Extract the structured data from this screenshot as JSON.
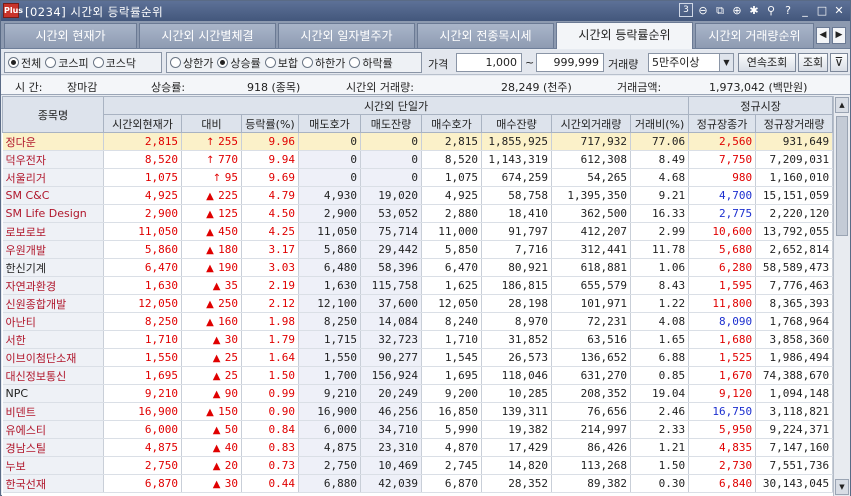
{
  "window": {
    "title": "[0234] 시간외 등락률순위",
    "app_badge": "Plus"
  },
  "title_tools": [
    {
      "name": "screen-number-icon",
      "glyph": "3"
    },
    {
      "name": "zoom-out-icon",
      "glyph": "⊖"
    },
    {
      "name": "link-icon",
      "glyph": "⧉"
    },
    {
      "name": "zoom-in-icon",
      "glyph": "⊕"
    },
    {
      "name": "settings-icon",
      "glyph": "✱"
    },
    {
      "name": "pin-icon",
      "glyph": "⚲"
    },
    {
      "name": "help-icon",
      "glyph": "?"
    },
    {
      "name": "minimize-icon",
      "glyph": "_"
    },
    {
      "name": "maximize-icon",
      "glyph": "□"
    },
    {
      "name": "close-icon",
      "glyph": "✕"
    }
  ],
  "tabs": [
    {
      "label": "시간외 현재가",
      "active": false
    },
    {
      "label": "시간외 시간별체결",
      "active": false
    },
    {
      "label": "시간외 일자별주가",
      "active": false
    },
    {
      "label": "시간외 전종목시세",
      "active": false
    },
    {
      "label": "시간외 등락률순위",
      "active": true
    },
    {
      "label": "시간외 거래량순위",
      "active": false
    }
  ],
  "tab_nav": {
    "prev": "◀",
    "next": "▶"
  },
  "filters": {
    "market": [
      {
        "label": "전체",
        "checked": true
      },
      {
        "label": "코스피",
        "checked": false
      },
      {
        "label": "코스닥",
        "checked": false
      }
    ],
    "trend": [
      {
        "label": "상한가",
        "checked": false
      },
      {
        "label": "상승률",
        "checked": true
      },
      {
        "label": "보합",
        "checked": false
      },
      {
        "label": "하한가",
        "checked": false
      },
      {
        "label": "하락률",
        "checked": false
      }
    ],
    "price_label": "가격",
    "price_min": "1,000",
    "price_sep": "~",
    "price_max": "999,999",
    "volume_label": "거래량",
    "volume_option": "5만주이상",
    "continuous_button": "연속조회",
    "query_button": "조회",
    "filter_icon": "filter-icon"
  },
  "info": {
    "time_label": "시 간:",
    "time_value": "장마감",
    "rising_label": "상승률:",
    "rising_value": "918 (종목)",
    "volume_label": "시간외 거래량:",
    "volume_value": "28,249 (천주)",
    "amount_label": "거래금액:",
    "amount_value": "1,973,042 (백만원)"
  },
  "table": {
    "group_headers": {
      "name": "종목명",
      "offhours": "시간외 단일가",
      "regular": "정규시장"
    },
    "columns": [
      "시간외현재가",
      "대비",
      "등락률(%)",
      "매도호가",
      "매도잔량",
      "매수호가",
      "매수잔량",
      "시간외거래량",
      "거래비(%)",
      "정규장종가",
      "정규장거래량"
    ],
    "rows": [
      {
        "name": "정다운",
        "name_color": "up",
        "price": "2,815",
        "arrow": "↑",
        "diff": "255",
        "rate": "9.96",
        "ask": "0",
        "ask_qty": "0",
        "bid": "2,815",
        "bid_qty": "1,855,925",
        "vol": "717,932",
        "ratio": "77.06",
        "close": "2,560",
        "close_color": "up",
        "reg_vol": "931,649",
        "selected": true
      },
      {
        "name": "덕우전자",
        "name_color": "up",
        "price": "8,520",
        "arrow": "↑",
        "diff": "770",
        "rate": "9.94",
        "ask": "0",
        "ask_qty": "0",
        "bid": "8,520",
        "bid_qty": "1,143,319",
        "vol": "612,308",
        "ratio": "8.49",
        "close": "7,750",
        "close_color": "up",
        "reg_vol": "7,209,031",
        "selected": false
      },
      {
        "name": "서울리거",
        "name_color": "up",
        "price": "1,075",
        "arrow": "↑",
        "diff": "95",
        "rate": "9.69",
        "ask": "0",
        "ask_qty": "0",
        "bid": "1,075",
        "bid_qty": "674,259",
        "vol": "54,265",
        "ratio": "4.68",
        "close": "980",
        "close_color": "up",
        "reg_vol": "1,160,010",
        "selected": false
      },
      {
        "name": "SM C&C",
        "name_color": "up",
        "price": "4,925",
        "arrow": "▲",
        "diff": "225",
        "rate": "4.79",
        "ask": "4,930",
        "ask_qty": "19,020",
        "bid": "4,925",
        "bid_qty": "58,758",
        "vol": "1,395,350",
        "ratio": "9.21",
        "close": "4,700",
        "close_color": "dn",
        "reg_vol": "15,151,059",
        "selected": false
      },
      {
        "name": "SM Life Design",
        "name_color": "up",
        "price": "2,900",
        "arrow": "▲",
        "diff": "125",
        "rate": "4.50",
        "ask": "2,900",
        "ask_qty": "53,052",
        "bid": "2,880",
        "bid_qty": "18,410",
        "vol": "362,500",
        "ratio": "16.33",
        "close": "2,775",
        "close_color": "dn",
        "reg_vol": "2,220,120",
        "selected": false
      },
      {
        "name": "로보로보",
        "name_color": "up",
        "price": "11,050",
        "arrow": "▲",
        "diff": "450",
        "rate": "4.25",
        "ask": "11,050",
        "ask_qty": "75,714",
        "bid": "11,000",
        "bid_qty": "91,797",
        "vol": "412,207",
        "ratio": "2.99",
        "close": "10,600",
        "close_color": "up",
        "reg_vol": "13,792,055",
        "selected": false
      },
      {
        "name": "우원개발",
        "name_color": "up",
        "price": "5,860",
        "arrow": "▲",
        "diff": "180",
        "rate": "3.17",
        "ask": "5,860",
        "ask_qty": "29,442",
        "bid": "5,850",
        "bid_qty": "7,716",
        "vol": "312,441",
        "ratio": "11.78",
        "close": "5,680",
        "close_color": "up",
        "reg_vol": "2,652,814",
        "selected": false
      },
      {
        "name": "한신기계",
        "name_color": "blk",
        "price": "6,470",
        "arrow": "▲",
        "diff": "190",
        "rate": "3.03",
        "ask": "6,480",
        "ask_qty": "58,396",
        "bid": "6,470",
        "bid_qty": "80,921",
        "vol": "618,881",
        "ratio": "1.06",
        "close": "6,280",
        "close_color": "up",
        "reg_vol": "58,589,473",
        "selected": false
      },
      {
        "name": "자연과환경",
        "name_color": "up",
        "price": "1,630",
        "arrow": "▲",
        "diff": "35",
        "rate": "2.19",
        "ask": "1,630",
        "ask_qty": "115,758",
        "bid": "1,625",
        "bid_qty": "186,815",
        "vol": "655,579",
        "ratio": "8.43",
        "close": "1,595",
        "close_color": "up",
        "reg_vol": "7,776,463",
        "selected": false
      },
      {
        "name": "신원종합개발",
        "name_color": "up",
        "price": "12,050",
        "arrow": "▲",
        "diff": "250",
        "rate": "2.12",
        "ask": "12,100",
        "ask_qty": "37,600",
        "bid": "12,050",
        "bid_qty": "28,198",
        "vol": "101,971",
        "ratio": "1.22",
        "close": "11,800",
        "close_color": "up",
        "reg_vol": "8,365,393",
        "selected": false
      },
      {
        "name": "아난티",
        "name_color": "up",
        "price": "8,250",
        "arrow": "▲",
        "diff": "160",
        "rate": "1.98",
        "ask": "8,250",
        "ask_qty": "14,084",
        "bid": "8,240",
        "bid_qty": "8,970",
        "vol": "72,231",
        "ratio": "4.08",
        "close": "8,090",
        "close_color": "dn",
        "reg_vol": "1,768,964",
        "selected": false
      },
      {
        "name": "서한",
        "name_color": "up",
        "price": "1,710",
        "arrow": "▲",
        "diff": "30",
        "rate": "1.79",
        "ask": "1,715",
        "ask_qty": "32,723",
        "bid": "1,710",
        "bid_qty": "31,852",
        "vol": "63,516",
        "ratio": "1.65",
        "close": "1,680",
        "close_color": "up",
        "reg_vol": "3,858,360",
        "selected": false
      },
      {
        "name": "이브이첨단소재",
        "name_color": "up",
        "price": "1,550",
        "arrow": "▲",
        "diff": "25",
        "rate": "1.64",
        "ask": "1,550",
        "ask_qty": "90,277",
        "bid": "1,545",
        "bid_qty": "26,573",
        "vol": "136,652",
        "ratio": "6.88",
        "close": "1,525",
        "close_color": "up",
        "reg_vol": "1,986,494",
        "selected": false
      },
      {
        "name": "대신정보통신",
        "name_color": "up",
        "price": "1,695",
        "arrow": "▲",
        "diff": "25",
        "rate": "1.50",
        "ask": "1,700",
        "ask_qty": "156,924",
        "bid": "1,695",
        "bid_qty": "118,046",
        "vol": "631,270",
        "ratio": "0.85",
        "close": "1,670",
        "close_color": "up",
        "reg_vol": "74,388,670",
        "selected": false
      },
      {
        "name": "NPC",
        "name_color": "blk",
        "price": "9,210",
        "arrow": "▲",
        "diff": "90",
        "rate": "0.99",
        "ask": "9,210",
        "ask_qty": "20,249",
        "bid": "9,200",
        "bid_qty": "10,285",
        "vol": "208,352",
        "ratio": "19.04",
        "close": "9,120",
        "close_color": "up",
        "reg_vol": "1,094,148",
        "selected": false
      },
      {
        "name": "비덴트",
        "name_color": "up",
        "price": "16,900",
        "arrow": "▲",
        "diff": "150",
        "rate": "0.90",
        "ask": "16,900",
        "ask_qty": "46,256",
        "bid": "16,850",
        "bid_qty": "139,311",
        "vol": "76,656",
        "ratio": "2.46",
        "close": "16,750",
        "close_color": "dn",
        "reg_vol": "3,118,821",
        "selected": false
      },
      {
        "name": "유에스티",
        "name_color": "up",
        "price": "6,000",
        "arrow": "▲",
        "diff": "50",
        "rate": "0.84",
        "ask": "6,000",
        "ask_qty": "34,710",
        "bid": "5,990",
        "bid_qty": "19,382",
        "vol": "214,997",
        "ratio": "2.33",
        "close": "5,950",
        "close_color": "up",
        "reg_vol": "9,224,371",
        "selected": false
      },
      {
        "name": "경남스틸",
        "name_color": "up",
        "price": "4,875",
        "arrow": "▲",
        "diff": "40",
        "rate": "0.83",
        "ask": "4,875",
        "ask_qty": "23,310",
        "bid": "4,870",
        "bid_qty": "17,429",
        "vol": "86,426",
        "ratio": "1.21",
        "close": "4,835",
        "close_color": "up",
        "reg_vol": "7,147,160",
        "selected": false
      },
      {
        "name": "누보",
        "name_color": "up",
        "price": "2,750",
        "arrow": "▲",
        "diff": "20",
        "rate": "0.73",
        "ask": "2,750",
        "ask_qty": "10,469",
        "bid": "2,745",
        "bid_qty": "14,820",
        "vol": "113,268",
        "ratio": "1.50",
        "close": "2,730",
        "close_color": "up",
        "reg_vol": "7,551,736",
        "selected": false
      },
      {
        "name": "한국선재",
        "name_color": "up",
        "price": "6,870",
        "arrow": "▲",
        "diff": "30",
        "rate": "0.44",
        "ask": "6,880",
        "ask_qty": "42,039",
        "bid": "6,870",
        "bid_qty": "28,352",
        "vol": "89,382",
        "ratio": "0.30",
        "close": "6,840",
        "close_color": "up",
        "reg_vol": "30,143,045",
        "selected": false
      }
    ]
  },
  "colors": {
    "up": "#e00000",
    "down": "#1c2fcf",
    "selected_row": "#fbf1c9",
    "header_bg": "#dde3ec",
    "titlebar": "#4b5f84"
  }
}
